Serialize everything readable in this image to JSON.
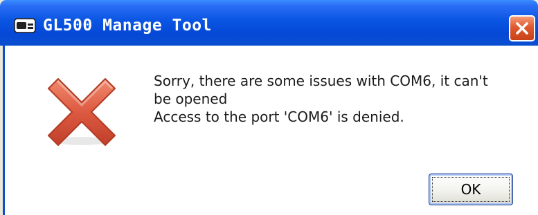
{
  "window": {
    "title": "GL500 Manage Tool",
    "icon": "app-icon",
    "close_icon": "close-icon"
  },
  "dialog": {
    "icon": "error-icon",
    "message_line1": "Sorry, there are some issues with COM6, it can't",
    "message_line2": "be opened",
    "message_line3": "Access to the port 'COM6' is denied.",
    "ok_label": "OK"
  },
  "colors": {
    "titlebar": "#0a55e3",
    "close_button": "#e0582e",
    "error_icon": "#d9543c"
  }
}
